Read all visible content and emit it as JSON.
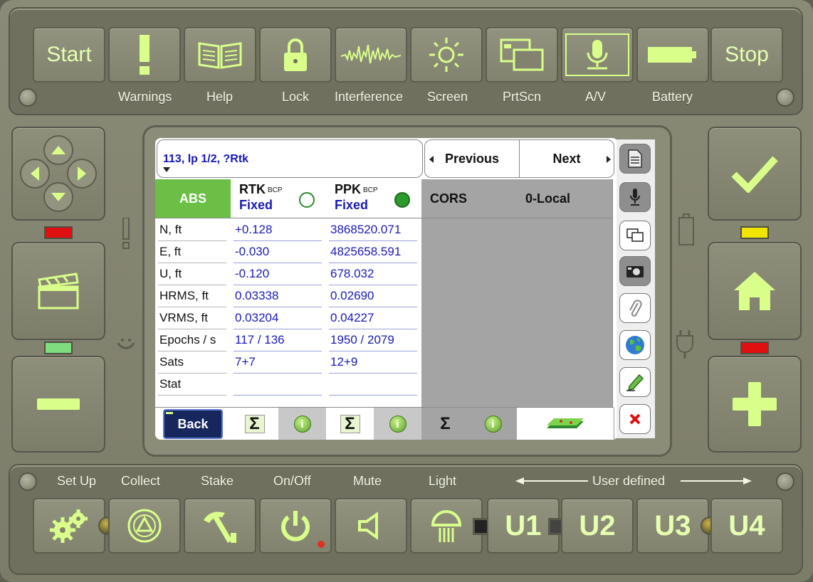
{
  "top_bar": {
    "start_label": "Start",
    "stop_label": "Stop",
    "labels": [
      "Warnings",
      "Help",
      "Lock",
      "Interference",
      "Screen",
      "PrtScn",
      "A/V",
      "Battery"
    ]
  },
  "bottom_bar": {
    "labels": [
      "Set Up",
      "Collect",
      "Stake",
      "On/Off",
      "Mute",
      "Light"
    ],
    "user_defined_label": "User defined",
    "u_buttons": [
      "U1",
      "U2",
      "U3",
      "U4"
    ]
  },
  "leds": {
    "left_top": "#e01010",
    "left_mid": "#7fdc7f",
    "right_top": "#f2e600",
    "right_mid": "#e01010"
  },
  "screen": {
    "title": "113, lp 1/2, ?Rtk",
    "previous_label": "Previous",
    "next_label": "Next",
    "columns": [
      {
        "header": "ABS"
      },
      {
        "header": "RTK",
        "header_sub": "BCP",
        "status": "Fixed"
      },
      {
        "header": "PPK",
        "header_sub": "BCP",
        "status": "Fixed"
      },
      {
        "header": "CORS"
      },
      {
        "header": "0-Local"
      }
    ],
    "row_labels": [
      "N, ft",
      "E, ft",
      "U, ft",
      "HRMS, ft",
      "VRMS, ft",
      "Epochs / s",
      "Sats",
      "Stat"
    ],
    "rtk_values": [
      "+0.128",
      "-0.030",
      "-0.120",
      "0.03338",
      "0.03204",
      "117 / 136",
      "7+7",
      ""
    ],
    "ppk_values": [
      "3868520.071",
      "4825658.591",
      "678.032",
      "0.02690",
      "0.04227",
      "1950 / 2079",
      "12+9",
      ""
    ],
    "back_label": "Back",
    "sigma": "Σ",
    "info": "i"
  },
  "colors": {
    "accent_green": "#6cbf46",
    "text_blue": "#1a1ab5",
    "button_glyph": "#d9ff8a"
  }
}
